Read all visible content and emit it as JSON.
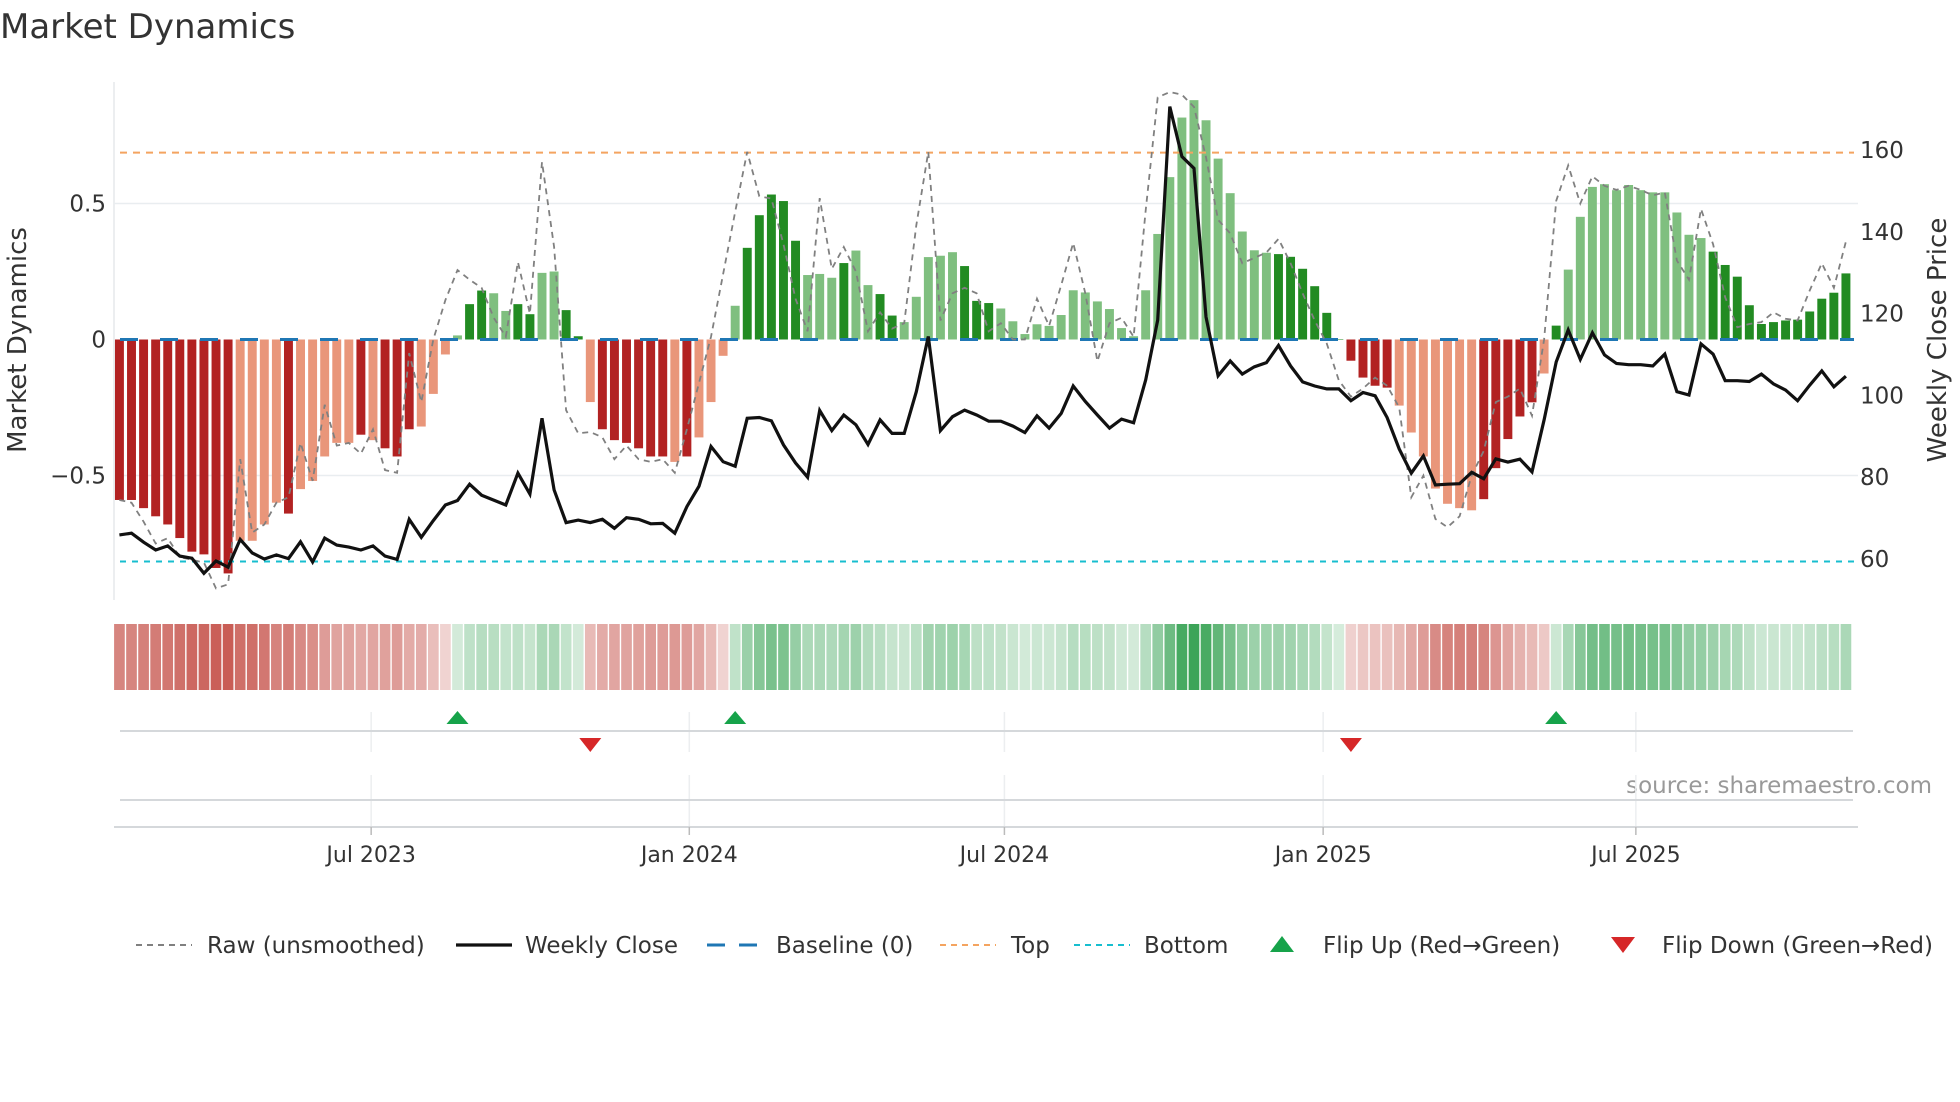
{
  "chart_data": {
    "type": "bar",
    "title": "Market Dynamics",
    "ylabel": "Market Dynamics",
    "ylabel_right": "Weekly Close Price",
    "source": "source: sharemaestro.com",
    "ylim": [
      -0.96,
      0.95
    ],
    "ylim_right": [
      50,
      176.6
    ],
    "xlim_weeks": [
      -0.45,
      144
    ],
    "yticks": [
      {
        "value": 0.5,
        "label": "0.5"
      },
      {
        "value": 0,
        "label": "0"
      },
      {
        "value": -0.5,
        "label": "−0.5"
      }
    ],
    "yticks_right": [
      {
        "value": 160,
        "label": "160"
      },
      {
        "value": 140,
        "label": "140"
      },
      {
        "value": 120,
        "label": "120"
      },
      {
        "value": 100,
        "label": "100"
      },
      {
        "value": 80,
        "label": "80"
      },
      {
        "value": 60,
        "label": "60"
      }
    ],
    "xticks": [
      {
        "week": 20.85,
        "label": "Jul 2023"
      },
      {
        "week": 47.2,
        "label": "Jan 2024"
      },
      {
        "week": 73.3,
        "label": "Jul 2024"
      },
      {
        "week": 99.7,
        "label": "Jan 2025"
      },
      {
        "week": 125.6,
        "label": "Jul 2025"
      }
    ],
    "reference_lines": {
      "baseline": 0,
      "top": 0.687,
      "bottom": -0.816
    },
    "colors": {
      "neg_strong": "#b22222",
      "neg_weak": "#e9967a",
      "pos_strong": "#228b22",
      "pos_weak": "#7fbf7f",
      "raw": "#808080",
      "close": "#111111",
      "baseline": "#1f77b4",
      "top": "#f4a460",
      "bottom": "#17becf",
      "flip_up": "#16a34a",
      "flip_down": "#d62728",
      "strip_red": "#c44e46",
      "strip_green": "#2e9e4c"
    },
    "series": [
      {
        "name": "Market Dynamics (smoothed)",
        "type": "bar",
        "values": [
          -0.59,
          -0.59,
          -0.62,
          -0.65,
          -0.68,
          -0.73,
          -0.78,
          -0.79,
          -0.84,
          -0.86,
          -0.74,
          -0.74,
          -0.68,
          -0.6,
          -0.64,
          -0.55,
          -0.52,
          -0.43,
          -0.38,
          -0.38,
          -0.35,
          -0.37,
          -0.4,
          -0.43,
          -0.33,
          -0.32,
          -0.2,
          -0.055,
          0.015,
          0.13,
          0.18,
          0.17,
          0.105,
          0.13,
          0.093,
          0.245,
          0.25,
          0.108,
          0.012,
          -0.23,
          -0.33,
          -0.37,
          -0.38,
          -0.4,
          -0.43,
          -0.43,
          -0.45,
          -0.43,
          -0.36,
          -0.23,
          -0.06,
          0.124,
          0.337,
          0.457,
          0.533,
          0.509,
          0.363,
          0.237,
          0.241,
          0.227,
          0.281,
          0.327,
          0.2,
          0.167,
          0.088,
          0.064,
          0.157,
          0.303,
          0.308,
          0.321,
          0.27,
          0.142,
          0.134,
          0.114,
          0.067,
          0.02,
          0.056,
          0.05,
          0.09,
          0.181,
          0.173,
          0.14,
          0.112,
          0.042,
          0.012,
          0.181,
          0.388,
          0.597,
          0.816,
          0.88,
          0.806,
          0.665,
          0.538,
          0.397,
          0.328,
          0.319,
          0.314,
          0.304,
          0.26,
          0.196,
          0.098,
          0.0,
          -0.078,
          -0.14,
          -0.17,
          -0.177,
          -0.243,
          -0.342,
          -0.43,
          -0.548,
          -0.604,
          -0.62,
          -0.628,
          -0.587,
          -0.473,
          -0.366,
          -0.283,
          -0.231,
          -0.125,
          0.051,
          0.257,
          0.451,
          0.561,
          0.571,
          0.549,
          0.568,
          0.549,
          0.541,
          0.541,
          0.467,
          0.385,
          0.373,
          0.323,
          0.274,
          0.231,
          0.126,
          0.057,
          0.064,
          0.07,
          0.073,
          0.103,
          0.15,
          0.172,
          0.243
        ],
        "shade": "dddddddddd"
      },
      {
        "name": "Raw (unsmoothed)",
        "type": "line",
        "values": [
          -0.59,
          -0.6,
          -0.67,
          -0.75,
          -0.73,
          -0.8,
          -0.81,
          -0.82,
          -0.915,
          -0.9,
          -0.44,
          -0.71,
          -0.68,
          -0.6,
          -0.58,
          -0.38,
          -0.52,
          -0.24,
          -0.39,
          -0.38,
          -0.42,
          -0.33,
          -0.48,
          -0.49,
          -0.05,
          -0.23,
          0.0,
          0.145,
          0.255,
          0.22,
          0.19,
          0.08,
          0.01,
          0.285,
          0.095,
          0.653,
          0.34,
          -0.26,
          -0.345,
          -0.34,
          -0.36,
          -0.44,
          -0.39,
          -0.44,
          -0.45,
          -0.44,
          -0.49,
          -0.33,
          -0.16,
          0.01,
          0.24,
          0.47,
          0.69,
          0.527,
          0.518,
          0.35,
          0.15,
          0.03,
          0.52,
          0.26,
          0.34,
          0.25,
          0.03,
          0.1,
          0.04,
          0.06,
          0.42,
          0.69,
          0.07,
          0.17,
          0.19,
          0.17,
          0.03,
          0.06,
          0.0,
          0.0,
          0.15,
          0.05,
          0.2,
          0.355,
          0.17,
          -0.08,
          0.06,
          0.08,
          0.01,
          0.475,
          0.89,
          0.91,
          0.9,
          0.855,
          0.67,
          0.44,
          0.39,
          0.28,
          0.3,
          0.32,
          0.37,
          0.28,
          0.17,
          0.07,
          -0.015,
          -0.15,
          -0.21,
          -0.18,
          -0.14,
          -0.17,
          -0.25,
          -0.58,
          -0.5,
          -0.66,
          -0.69,
          -0.65,
          -0.5,
          -0.41,
          -0.23,
          -0.21,
          -0.18,
          -0.28,
          0.0,
          0.51,
          0.64,
          0.5,
          0.6,
          0.565,
          0.55,
          0.565,
          0.55,
          0.53,
          0.54,
          0.29,
          0.22,
          0.48,
          0.35,
          0.155,
          0.045,
          0.057,
          0.064,
          0.1,
          0.076,
          0.07,
          0.18,
          0.28,
          0.19,
          0.36
        ]
      },
      {
        "name": "Weekly Close",
        "type": "line",
        "axis": "right",
        "values": [
          65.9,
          66.3,
          64.1,
          62.2,
          63.2,
          60.7,
          60.2,
          56.5,
          59.5,
          58.0,
          64.8,
          61.5,
          60.0,
          61.0,
          60.1,
          64.2,
          59.3,
          65.1,
          63.4,
          62.9,
          62.2,
          63.2,
          60.7,
          59.9,
          69.7,
          65.3,
          69.4,
          73.2,
          74.3,
          78.3,
          75.6,
          74.4,
          73.2,
          81.0,
          75.9,
          94.4,
          76.9,
          68.9,
          69.5,
          68.9,
          69.7,
          67.5,
          70.1,
          69.7,
          68.6,
          68.7,
          66.3,
          72.8,
          77.8,
          87.5,
          83.8,
          82.7,
          94.4,
          94.6,
          93.8,
          87.9,
          83.5,
          80.0,
          96.3,
          91.4,
          95.2,
          92.8,
          88.0,
          94.0,
          90.7,
          90.7,
          100.9,
          114.4,
          91.4,
          94.8,
          96.4,
          95.2,
          93.7,
          93.7,
          92.5,
          90.9,
          95.0,
          92.0,
          95.6,
          102.3,
          98.5,
          95.2,
          92.0,
          94.2,
          93.3,
          103.8,
          118.4,
          170.6,
          158.4,
          155.5,
          119.2,
          104.8,
          108.4,
          105.2,
          107.0,
          108.0,
          112.2,
          107.2,
          103.3,
          102.3,
          101.6,
          101.6,
          98.7,
          100.7,
          99.9,
          94.6,
          86.9,
          81.0,
          85.2,
          78.1,
          78.3,
          78.4,
          81.2,
          79.6,
          84.5,
          83.7,
          84.4,
          81.3,
          94.0,
          108.2,
          116.0,
          108.8,
          115.3,
          109.9,
          107.8,
          107.5,
          107.5,
          107.2,
          110.1,
          100.9,
          100.1,
          112.6,
          110.1,
          103.6,
          103.6,
          103.4,
          105.2,
          102.8,
          101.3,
          98.7,
          102.5,
          106.0,
          102.1,
          104.7
        ]
      }
    ],
    "bar_shade": "ddddddddddlllldllllldlddd llllddllddlldd lddddddldlllldddddllldllddllllldd dlllllllllllllllllllllllddddddddddllllllldddddldlllllllllllldddddddd",
    "flips": [
      {
        "week": 28,
        "type": "up"
      },
      {
        "week": 39,
        "type": "down"
      },
      {
        "week": 51,
        "type": "up"
      },
      {
        "week": 102,
        "type": "down"
      },
      {
        "week": 119,
        "type": "up"
      }
    ],
    "legend": {
      "placement": "bottom",
      "items": [
        {
          "label": "Raw (unsmoothed)",
          "style": "dashed-line",
          "color": "#808080"
        },
        {
          "label": "Weekly Close",
          "style": "solid-line",
          "color": "#111111"
        },
        {
          "label": "Baseline (0)",
          "style": "long-dash-line",
          "color": "#1f77b4"
        },
        {
          "label": "Top",
          "style": "dashed-line",
          "color": "#f4a460"
        },
        {
          "label": "Bottom",
          "style": "dotted-line",
          "color": "#17becf"
        },
        {
          "label": "Flip Up (Red→Green)",
          "style": "triangle-up",
          "color": "#16a34a"
        },
        {
          "label": "Flip Down (Green→Red)",
          "style": "triangle-down",
          "color": "#d62728"
        }
      ]
    }
  }
}
